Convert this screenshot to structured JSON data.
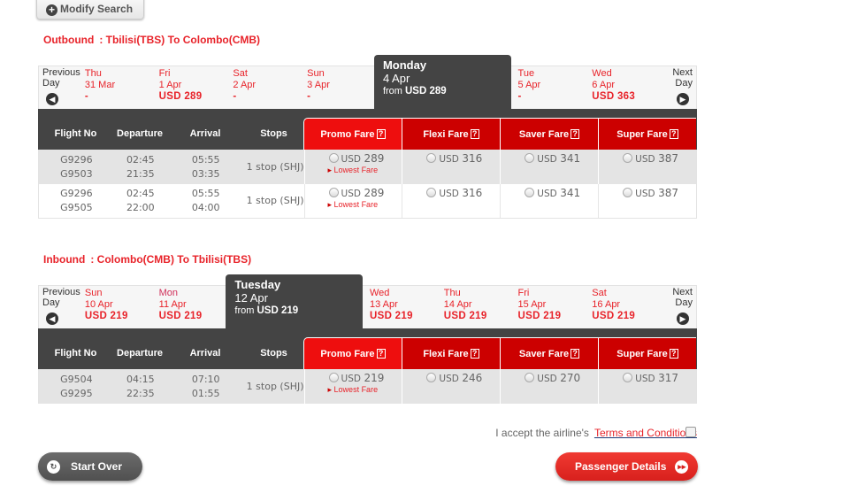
{
  "modify_search": "Modify Search",
  "columns": {
    "flight_no": "Flight No",
    "departure": "Departure",
    "arrival": "Arrival",
    "stops": "Stops",
    "fares": [
      "Promo Fare",
      "Flexi Fare",
      "Saver Fare",
      "Super Fare"
    ],
    "help": "?"
  },
  "nav": {
    "prev": "Previous Day",
    "next": "Next Day"
  },
  "lowest_label": "Lowest Fare",
  "sections": [
    {
      "label": "Outbound",
      "route": ": Tbilisi(TBS) To Colombo(CMB)",
      "dates": [
        {
          "day": "Thu",
          "date": "31 Mar",
          "price": "-"
        },
        {
          "day": "Fri",
          "date": "1 Apr",
          "price": "USD 289"
        },
        {
          "day": "Sat",
          "date": "2 Apr",
          "price": "-"
        },
        {
          "day": "Sun",
          "date": "3 Apr",
          "price": "-"
        },
        {
          "day": "Monday",
          "date": "4 Apr",
          "price": "USD 289",
          "from": "from",
          "selected": true
        },
        {
          "day": "Tue",
          "date": "5 Apr",
          "price": "-"
        },
        {
          "day": "Wed",
          "date": "6 Apr",
          "price": "USD 363"
        }
      ],
      "flights": [
        {
          "flights": [
            "G9296",
            "G9503"
          ],
          "dep": [
            "02:45",
            "21:35"
          ],
          "arr": [
            "05:55",
            "03:35"
          ],
          "stops": "1 stop (SHJ)",
          "fares": [
            [
              "USD",
              "289"
            ],
            [
              "USD",
              "316"
            ],
            [
              "USD",
              "341"
            ],
            [
              "USD",
              "387"
            ]
          ],
          "lowest": true
        },
        {
          "flights": [
            "G9296",
            "G9505"
          ],
          "dep": [
            "02:45",
            "22:00"
          ],
          "arr": [
            "05:55",
            "04:00"
          ],
          "stops": "1 stop (SHJ)",
          "fares": [
            [
              "USD",
              "289"
            ],
            [
              "USD",
              "316"
            ],
            [
              "USD",
              "341"
            ],
            [
              "USD",
              "387"
            ]
          ],
          "lowest": true
        }
      ]
    },
    {
      "label": "Inbound",
      "route": ": Colombo(CMB) To Tbilisi(TBS)",
      "dates": [
        {
          "day": "Sun",
          "date": "10 Apr",
          "price": "USD 219"
        },
        {
          "day": "Mon",
          "date": "11 Apr",
          "price": "USD 219"
        },
        {
          "day": "Tuesday",
          "date": "12 Apr",
          "price": "USD 219",
          "from": "from",
          "selected": true
        },
        {
          "day": "Wed",
          "date": "13 Apr",
          "price": "USD 219"
        },
        {
          "day": "Thu",
          "date": "14 Apr",
          "price": "USD 219"
        },
        {
          "day": "Fri",
          "date": "15 Apr",
          "price": "USD 219"
        },
        {
          "day": "Sat",
          "date": "16 Apr",
          "price": "USD 219"
        }
      ],
      "flights": [
        {
          "flights": [
            "G9504",
            "G9295"
          ],
          "dep": [
            "04:15",
            "22:35"
          ],
          "arr": [
            "07:10",
            "01:55"
          ],
          "stops": "1 stop (SHJ)",
          "fares": [
            [
              "USD",
              "219"
            ],
            [
              "USD",
              "246"
            ],
            [
              "USD",
              "270"
            ],
            [
              "USD",
              "317"
            ]
          ],
          "lowest": true
        }
      ]
    }
  ],
  "terms": {
    "text": "I accept the airline's",
    "link": "Terms and Conditions"
  },
  "buttons": {
    "start_over": "Start Over",
    "passenger_details": "Passenger Details"
  }
}
